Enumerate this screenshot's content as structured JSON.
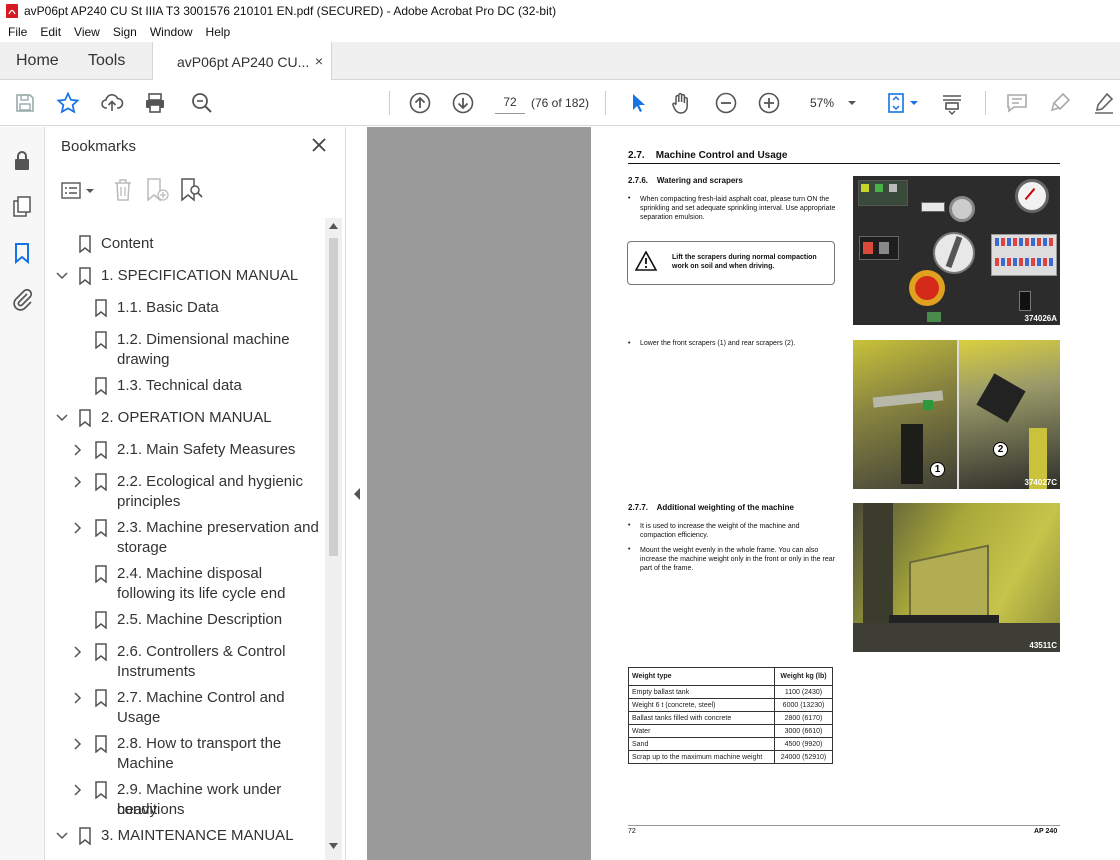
{
  "window": {
    "title": "avP06pt AP240 CU St IIIA T3 3001576 210101 EN.pdf (SECURED) - Adobe Acrobat Pro DC (32-bit)"
  },
  "menu": [
    "File",
    "Edit",
    "View",
    "Sign",
    "Window",
    "Help"
  ],
  "tabs": {
    "home": "Home",
    "tools": "Tools",
    "doc": "avP06pt AP240 CU...",
    "close": "×"
  },
  "toolbar": {
    "page_current": "72",
    "page_of": "(76 of 182)",
    "zoom": "57%",
    "icons": [
      "save-icon",
      "star-icon",
      "upload-icon",
      "print-icon",
      "zoom-search-icon",
      "page-up-icon",
      "page-down-icon",
      "select-cursor-icon",
      "hand-icon",
      "zoom-out-icon",
      "zoom-in-icon",
      "fit-page-icon",
      "scroll-mode-icon",
      "comment-icon",
      "highlight-icon",
      "sign-icon"
    ]
  },
  "bookmarks": {
    "title": "Bookmarks",
    "items": [
      {
        "label": "Content"
      },
      {
        "label": "1. SPECIFICATION MANUAL"
      },
      {
        "label": "1.1. Basic Data"
      },
      {
        "label": "1.2. Dimensional machine"
      },
      {
        "label": "drawing"
      },
      {
        "label": "1.3. Technical data"
      },
      {
        "label": "2. OPERATION MANUAL"
      },
      {
        "label": "2.1. Main Safety Measures"
      },
      {
        "label": "2.2. Ecological and hygienic"
      },
      {
        "label": "principles"
      },
      {
        "label": "2.3. Machine preservation and"
      },
      {
        "label": "storage"
      },
      {
        "label": "2.4. Machine disposal"
      },
      {
        "label": "following its life cycle end"
      },
      {
        "label": "2.5. Machine Description"
      },
      {
        "label": "2.6. Controllers & Control"
      },
      {
        "label": "Instruments"
      },
      {
        "label": "2.7. Machine Control and"
      },
      {
        "label": "Usage"
      },
      {
        "label": "2.8. How to transport the"
      },
      {
        "label": "Machine"
      },
      {
        "label": "2.9. Machine work under heavy"
      },
      {
        "label": "conditions"
      },
      {
        "label": "3. MAINTENANCE MANUAL"
      }
    ]
  },
  "page": {
    "section": "2.7.    Machine Control and Usage",
    "sub1": "2.7.6.    Watering and scrapers",
    "bullet1": "When compacting fresh-laid asphalt coat, please turn ON the sprinkling and set adequate sprinkling interval. Use appropriate separation emulsion.",
    "warning": "Lift the scrapers during normal compaction work on soil and when driving.",
    "photo1_code": "374026A",
    "bullet2": "Lower the front scrapers (1) and rear scrapers (2).",
    "photo2_code": "374027C",
    "photo2_label1": "1",
    "photo2_label2": "2",
    "sub2": "2.7.7.    Additional weighting of the machine",
    "bullet3": "It is used to increase the weight of the machine and compaction efficiency.",
    "bullet4": "Mount the weight evenly in the whole frame. You can also increase the machine weight only in the front or only in the rear part of the frame.",
    "photo3_code": "43511C",
    "table": {
      "headers": [
        "Weight type",
        "Weight kg (lb)"
      ],
      "rows": [
        [
          "Empty ballast tank",
          "1100 (2430)"
        ],
        [
          "Weight 6 t (concrete, steel)",
          "6000 (13230)"
        ],
        [
          "Ballast tanks filled with concrete",
          "2800 (6170)"
        ],
        [
          "Water",
          "3000 (6610)"
        ],
        [
          "Sand",
          "4500 (9920)"
        ],
        [
          "Scrap up to the maximum machine weight",
          "24000 (52910)"
        ]
      ]
    },
    "footer_left": "72",
    "footer_right": "AP 240"
  },
  "colors": {
    "acrobat_red": "#d71920",
    "accent_blue": "#1473e6",
    "doc_bg": "#9a9a9a"
  }
}
